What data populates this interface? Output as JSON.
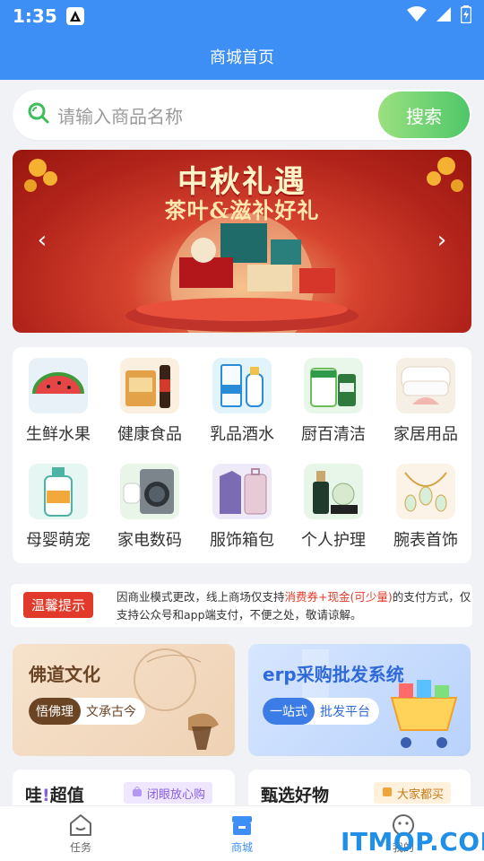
{
  "status_bar": {
    "time": "1:35"
  },
  "header": {
    "title": "商城首页"
  },
  "search": {
    "placeholder": "请输入商品名称",
    "button_label": "搜索"
  },
  "banner": {
    "title": "中秋礼遇",
    "subtitle": "茶叶&滋补好礼"
  },
  "categories": [
    {
      "label": "生鲜水果",
      "icon": "watermelon-icon"
    },
    {
      "label": "健康食品",
      "icon": "health-food-icon"
    },
    {
      "label": "乳品酒水",
      "icon": "milk-drink-icon"
    },
    {
      "label": "厨百清洁",
      "icon": "baby-formula-icon"
    },
    {
      "label": "家居用品",
      "icon": "pillow-icon"
    },
    {
      "label": "母婴萌宠",
      "icon": "lotion-bottle-icon"
    },
    {
      "label": "家电数码",
      "icon": "washer-earbuds-icon"
    },
    {
      "label": "服饰箱包",
      "icon": "jacket-suitcase-icon"
    },
    {
      "label": "个人护理",
      "icon": "skincare-bottle-icon"
    },
    {
      "label": "腕表首饰",
      "icon": "jewelry-icon"
    }
  ],
  "notice": {
    "tag": "温馨提示",
    "text_before": "因商业模式更改，线上商场仅支持",
    "highlight": "消费券+现金(可少量)",
    "text_after": "的支付方式，仅支持公众号和app端支付，不便之处，敬请谅解。"
  },
  "promos": [
    {
      "title": "佛道文化",
      "pill_primary": "悟佛理",
      "pill_secondary": "文承古今"
    },
    {
      "title": "erp采购批发系统",
      "pill_primary": "一站式",
      "pill_secondary": "批发平台"
    }
  ],
  "sections": [
    {
      "title_part1": "哇",
      "title_part2": "!",
      "title_part3": "超值",
      "chip": "闭眼放心购"
    },
    {
      "title": "甄选好物",
      "chip": "大家都买"
    }
  ],
  "tabs": [
    {
      "label": "任务"
    },
    {
      "label": "商城"
    },
    {
      "label": "我的"
    }
  ],
  "watermark": "ITMOP.COM",
  "colors": {
    "primary": "#3d8ef5",
    "accent_red": "#e23a2a",
    "search_green": "#4ec769"
  }
}
